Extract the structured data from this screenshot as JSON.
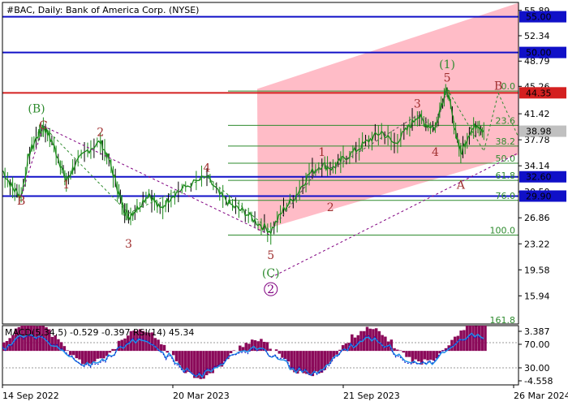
{
  "chart_data": {
    "type": "line",
    "title": "#BAC, Daily:  Bank of America Corp. (NYSE)",
    "symbol": "#BAC",
    "timeframe": "Daily",
    "instrument": "Bank of America Corp. (NYSE)",
    "y_ticks": [
      "55.89",
      "52.34",
      "48.79",
      "45.26",
      "41.42",
      "37.78",
      "34.14",
      "30.50",
      "26.86",
      "23.22",
      "19.58",
      "15.94"
    ],
    "y_tick_values": [
      55.89,
      52.34,
      48.79,
      45.26,
      41.42,
      37.78,
      34.14,
      30.5,
      26.86,
      23.22,
      19.58,
      15.94
    ],
    "ylim": [
      12.0,
      57.0
    ],
    "x_ticks": [
      {
        "label": "14 Sep 2022",
        "t": 0.0
      },
      {
        "label": "20 Mar 2023",
        "t": 0.2
      },
      {
        "label": "21 Sep 2023",
        "t": 0.4
      },
      {
        "label": "26 Mar 2024",
        "t": 0.6
      }
    ],
    "horizontal_levels": [
      {
        "label": "55.00",
        "value": 55.0,
        "color": "#1010c8"
      },
      {
        "label": "50.00",
        "value": 50.0,
        "color": "#1010c8"
      },
      {
        "label": "44.35",
        "value": 44.35,
        "color": "#d42020"
      },
      {
        "label": "32.60",
        "value": 32.6,
        "color": "#1010c8"
      },
      {
        "label": "29.90",
        "value": 29.9,
        "color": "#1010c8"
      }
    ],
    "current_price": {
      "label": "38.98",
      "value": 38.98
    },
    "fibonacci_levels": [
      {
        "label": "0.0",
        "value": 44.6
      },
      {
        "label": "23.6",
        "value": 39.8
      },
      {
        "label": "38.2",
        "value": 36.9
      },
      {
        "label": "50.0",
        "value": 34.5
      },
      {
        "label": "61.8",
        "value": 32.1
      },
      {
        "label": "76.0",
        "value": 29.3
      },
      {
        "label": "100.0",
        "value": 24.45
      },
      {
        "label": "161.8",
        "value": 11.9
      }
    ],
    "wave_labels": [
      {
        "text": "(B)",
        "t": 0.04,
        "v": 41.6,
        "color": "#2e8b2e"
      },
      {
        "text": "C",
        "t": 0.048,
        "v": 39.3,
        "color": "#a03030"
      },
      {
        "text": "B",
        "t": 0.022,
        "v": 28.7,
        "color": "#a03030"
      },
      {
        "text": "1",
        "t": 0.075,
        "v": 31.0,
        "color": "#a03030"
      },
      {
        "text": "2",
        "t": 0.115,
        "v": 38.3,
        "color": "#a03030"
      },
      {
        "text": "3",
        "t": 0.148,
        "v": 22.7,
        "color": "#a03030"
      },
      {
        "text": "4",
        "t": 0.24,
        "v": 33.3,
        "color": "#a03030"
      },
      {
        "text": "5",
        "t": 0.315,
        "v": 21.1,
        "color": "#a03030"
      },
      {
        "text": "(C)",
        "t": 0.315,
        "v": 18.6,
        "color": "#2e8b2e"
      },
      {
        "text": "2",
        "t": 0.315,
        "v": 16.3,
        "color": "#800080",
        "circled": true
      },
      {
        "text": "1",
        "t": 0.375,
        "v": 35.5,
        "color": "#a03030"
      },
      {
        "text": "2",
        "t": 0.385,
        "v": 27.8,
        "color": "#a03030"
      },
      {
        "text": "3",
        "t": 0.487,
        "v": 42.3,
        "color": "#a03030"
      },
      {
        "text": "4",
        "t": 0.508,
        "v": 35.5,
        "color": "#a03030"
      },
      {
        "text": "(1)",
        "t": 0.522,
        "v": 47.8,
        "color": "#2e8b2e"
      },
      {
        "text": "5",
        "t": 0.522,
        "v": 45.9,
        "color": "#a03030"
      },
      {
        "text": "A",
        "t": 0.538,
        "v": 30.9,
        "color": "#a03030"
      },
      {
        "text": "B",
        "t": 0.582,
        "v": 44.8,
        "color": "#a03030"
      },
      {
        "text": "C",
        "t": 0.627,
        "v": 29.9,
        "color": "#a03030"
      },
      {
        "text": "(2)",
        "t": 0.627,
        "v": 27.5,
        "color": "#2e8b2e"
      }
    ],
    "forecast_path": [
      {
        "t": 0.522,
        "v": 44.9
      },
      {
        "t": 0.565,
        "v": 36.2
      },
      {
        "t": 0.582,
        "v": 44.3
      },
      {
        "t": 0.627,
        "v": 32.6
      },
      {
        "t": 0.72,
        "v": 47.5
      }
    ],
    "series": [
      {
        "name": "",
        "values": [
          [
            0.0,
            33.5
          ],
          [
            0.012,
            31.0
          ],
          [
            0.022,
            29.9
          ],
          [
            0.032,
            36.0
          ],
          [
            0.042,
            38.6
          ],
          [
            0.048,
            39.7
          ],
          [
            0.058,
            37.6
          ],
          [
            0.068,
            34.4
          ],
          [
            0.075,
            31.9
          ],
          [
            0.085,
            34.3
          ],
          [
            0.1,
            36.3
          ],
          [
            0.115,
            37.5
          ],
          [
            0.125,
            35.0
          ],
          [
            0.135,
            31.0
          ],
          [
            0.142,
            28.3
          ],
          [
            0.148,
            27.0
          ],
          [
            0.158,
            28.2
          ],
          [
            0.172,
            30.3
          ],
          [
            0.185,
            28.0
          ],
          [
            0.198,
            29.9
          ],
          [
            0.215,
            31.2
          ],
          [
            0.24,
            32.6
          ],
          [
            0.255,
            30.1
          ],
          [
            0.27,
            28.5
          ],
          [
            0.285,
            27.6
          ],
          [
            0.3,
            26.1
          ],
          [
            0.315,
            25.0
          ],
          [
            0.33,
            28.0
          ],
          [
            0.345,
            30.1
          ],
          [
            0.36,
            33.0
          ],
          [
            0.375,
            34.3
          ],
          [
            0.388,
            33.8
          ],
          [
            0.4,
            35.1
          ],
          [
            0.415,
            36.3
          ],
          [
            0.43,
            37.7
          ],
          [
            0.445,
            38.9
          ],
          [
            0.46,
            37.2
          ],
          [
            0.475,
            39.2
          ],
          [
            0.487,
            41.2
          ],
          [
            0.497,
            40.0
          ],
          [
            0.508,
            39.4
          ],
          [
            0.515,
            42.8
          ],
          [
            0.522,
            44.8
          ],
          [
            0.53,
            40.0
          ],
          [
            0.538,
            35.8
          ],
          [
            0.548,
            38.8
          ],
          [
            0.558,
            40.0
          ],
          [
            0.565,
            39.0
          ]
        ]
      }
    ],
    "indicator": {
      "label": "MACD(5,34,5) -0.529 -0.397 RSI(14) 45.34",
      "y_ticks": [
        "3.387",
        "70.00",
        "30.00",
        "-4.558"
      ],
      "y_tick_values": [
        3.387,
        70.0,
        30.0,
        -4.558
      ],
      "colors": {
        "histogram": "#8b0a5a",
        "rsi": "#2090e8",
        "signal": "#1010c8"
      }
    },
    "colors": {
      "candle": "#1a8a1a",
      "channel": "#ffb8c4",
      "support": "#1010c8",
      "resistance": "#d42020",
      "fib": "#2e8b2e",
      "bear": "#000000"
    },
    "grid": false,
    "legend": "none"
  }
}
